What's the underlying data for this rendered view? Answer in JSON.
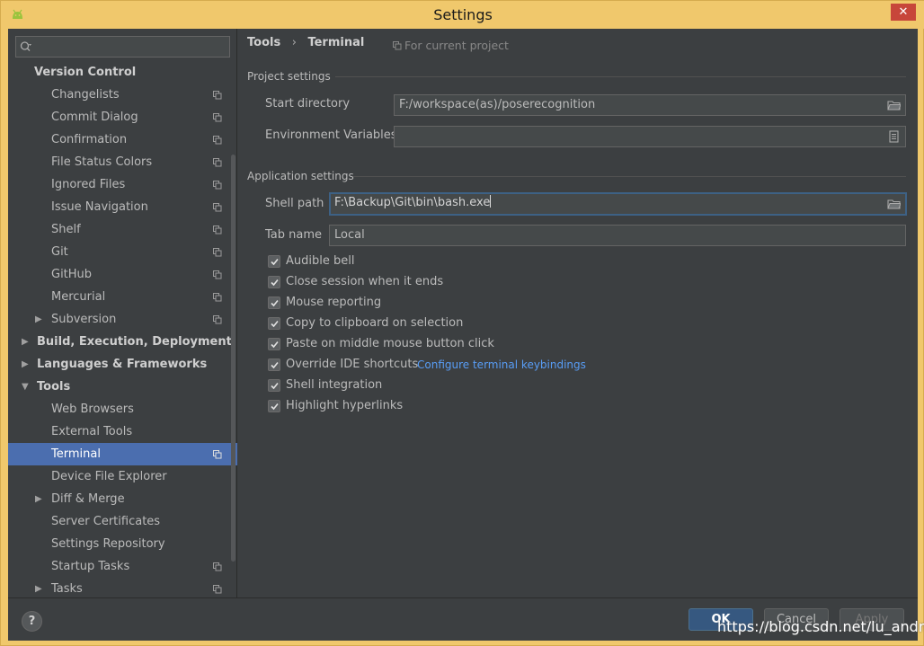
{
  "window": {
    "title": "Settings",
    "close_label": "✕"
  },
  "search": {
    "placeholder": ""
  },
  "sidebar": {
    "items": [
      {
        "label": "Version Control",
        "level": 0,
        "bold": true
      },
      {
        "label": "Changelists",
        "level": 1,
        "copy": true
      },
      {
        "label": "Commit Dialog",
        "level": 1,
        "copy": true
      },
      {
        "label": "Confirmation",
        "level": 1,
        "copy": true
      },
      {
        "label": "File Status Colors",
        "level": 1,
        "copy": true
      },
      {
        "label": "Ignored Files",
        "level": 1,
        "copy": true
      },
      {
        "label": "Issue Navigation",
        "level": 1,
        "copy": true
      },
      {
        "label": "Shelf",
        "level": 1,
        "copy": true
      },
      {
        "label": "Git",
        "level": 1,
        "copy": true
      },
      {
        "label": "GitHub",
        "level": 1,
        "copy": true
      },
      {
        "label": "Mercurial",
        "level": 1,
        "copy": true
      },
      {
        "label": "Subversion",
        "level": 1,
        "copy": true,
        "arrow": "right"
      },
      {
        "label": "Build, Execution, Deployment",
        "level": 0,
        "bold": true,
        "arrow": "right"
      },
      {
        "label": "Languages & Frameworks",
        "level": 0,
        "bold": true,
        "arrow": "right"
      },
      {
        "label": "Tools",
        "level": 0,
        "bold": true,
        "arrow": "down"
      },
      {
        "label": "Web Browsers",
        "level": 1
      },
      {
        "label": "External Tools",
        "level": 1
      },
      {
        "label": "Terminal",
        "level": 1,
        "copy": true,
        "selected": true
      },
      {
        "label": "Device File Explorer",
        "level": 1
      },
      {
        "label": "Diff & Merge",
        "level": 1,
        "arrow": "right"
      },
      {
        "label": "Server Certificates",
        "level": 1
      },
      {
        "label": "Settings Repository",
        "level": 1
      },
      {
        "label": "Startup Tasks",
        "level": 1,
        "copy": true
      },
      {
        "label": "Tasks",
        "level": 1,
        "copy": true,
        "arrow": "right"
      }
    ]
  },
  "breadcrumb": {
    "root": "Tools",
    "separator": "›",
    "current": "Terminal"
  },
  "scope_label": "For current project",
  "project_settings": {
    "heading": "Project settings",
    "start_directory_label": "Start directory",
    "start_directory_value": "F:/workspace(as)/poserecognition",
    "env_vars_label": "Environment Variables",
    "env_vars_value": ""
  },
  "application_settings": {
    "heading": "Application settings",
    "shell_path_label": "Shell path",
    "shell_path_value": "F:\\Backup\\Git\\bin\\bash.exe",
    "tab_name_label": "Tab name",
    "tab_name_value": "Local"
  },
  "checkboxes": [
    {
      "label": "Audible bell",
      "checked": true
    },
    {
      "label": "Close session when it ends",
      "checked": true
    },
    {
      "label": "Mouse reporting",
      "checked": true
    },
    {
      "label": "Copy to clipboard on selection",
      "checked": true
    },
    {
      "label": "Paste on middle mouse button click",
      "checked": true
    },
    {
      "label": "Override IDE shortcuts",
      "checked": true
    },
    {
      "label": "Shell integration",
      "checked": true
    },
    {
      "label": "Highlight hyperlinks",
      "checked": true
    }
  ],
  "keybindings_link": "Configure terminal keybindings",
  "footer": {
    "help_label": "?",
    "ok_label": "OK",
    "cancel_label": "Cancel",
    "apply_label": "Apply"
  },
  "watermark": "https://blog.csdn.net/lu_android",
  "colors": {
    "title_bar": "#f0c86c",
    "panel": "#3c3f41",
    "selection": "#4b6eaf",
    "link": "#589df6",
    "primary_button": "#365880"
  }
}
